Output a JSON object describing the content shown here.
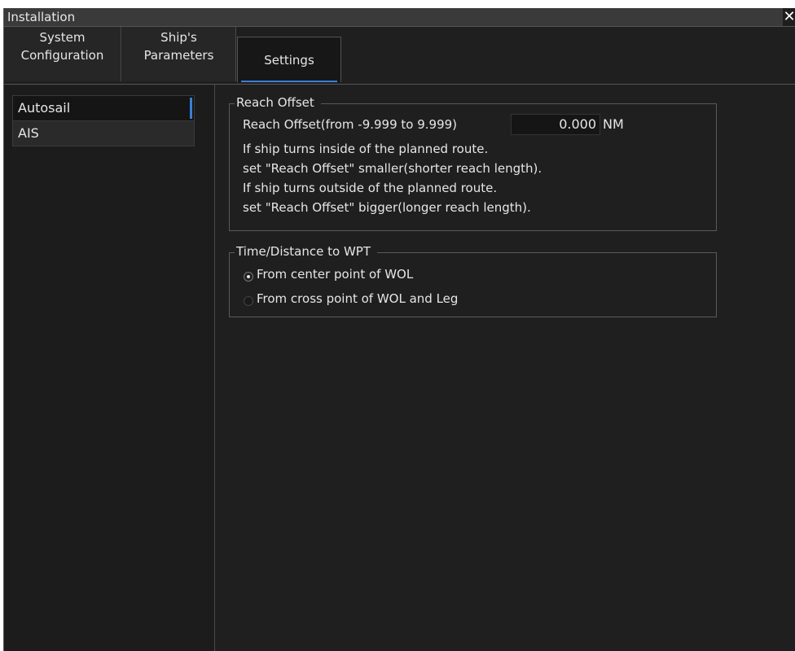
{
  "window": {
    "title": "Installation",
    "close_symbol": "✕"
  },
  "tabs": [
    {
      "line1": "System",
      "line2": "Configuration"
    },
    {
      "line1": "Ship's",
      "line2": "Parameters"
    },
    {
      "label": "Settings",
      "active": true
    }
  ],
  "sidebar": {
    "items": [
      {
        "label": "Autosail",
        "selected": true
      },
      {
        "label": "AIS",
        "selected": false
      }
    ]
  },
  "reach_offset": {
    "group_title": "Reach Offset",
    "field_label": "Reach Offset(from -9.999 to 9.999)",
    "value": "0.000",
    "unit": "NM",
    "help": [
      "If ship turns inside of the planned route.",
      "set \"Reach Offset\" smaller(shorter reach length).",
      "If ship turns outside of the planned route.",
      "set \"Reach Offset\" bigger(longer reach length)."
    ]
  },
  "time_distance": {
    "group_title": "Time/Distance to WPT",
    "options": [
      {
        "label": "From center point of WOL",
        "selected": true
      },
      {
        "label": "From cross point of WOL and Leg",
        "selected": false
      }
    ]
  },
  "colors": {
    "accent": "#3b7fd6",
    "background": "#1f1f1f"
  },
  "icons": {
    "close": "close-icon",
    "radio": "radio-icon"
  }
}
